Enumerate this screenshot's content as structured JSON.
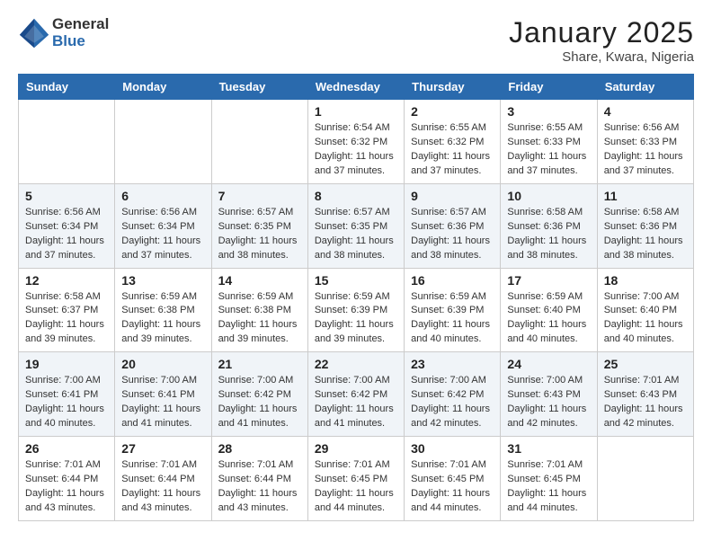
{
  "logo": {
    "general": "General",
    "blue": "Blue"
  },
  "title": "January 2025",
  "location": "Share, Kwara, Nigeria",
  "headers": [
    "Sunday",
    "Monday",
    "Tuesday",
    "Wednesday",
    "Thursday",
    "Friday",
    "Saturday"
  ],
  "weeks": [
    [
      {
        "day": "",
        "info": ""
      },
      {
        "day": "",
        "info": ""
      },
      {
        "day": "",
        "info": ""
      },
      {
        "day": "1",
        "info": "Sunrise: 6:54 AM\nSunset: 6:32 PM\nDaylight: 11 hours and 37 minutes."
      },
      {
        "day": "2",
        "info": "Sunrise: 6:55 AM\nSunset: 6:32 PM\nDaylight: 11 hours and 37 minutes."
      },
      {
        "day": "3",
        "info": "Sunrise: 6:55 AM\nSunset: 6:33 PM\nDaylight: 11 hours and 37 minutes."
      },
      {
        "day": "4",
        "info": "Sunrise: 6:56 AM\nSunset: 6:33 PM\nDaylight: 11 hours and 37 minutes."
      }
    ],
    [
      {
        "day": "5",
        "info": "Sunrise: 6:56 AM\nSunset: 6:34 PM\nDaylight: 11 hours and 37 minutes."
      },
      {
        "day": "6",
        "info": "Sunrise: 6:56 AM\nSunset: 6:34 PM\nDaylight: 11 hours and 37 minutes."
      },
      {
        "day": "7",
        "info": "Sunrise: 6:57 AM\nSunset: 6:35 PM\nDaylight: 11 hours and 38 minutes."
      },
      {
        "day": "8",
        "info": "Sunrise: 6:57 AM\nSunset: 6:35 PM\nDaylight: 11 hours and 38 minutes."
      },
      {
        "day": "9",
        "info": "Sunrise: 6:57 AM\nSunset: 6:36 PM\nDaylight: 11 hours and 38 minutes."
      },
      {
        "day": "10",
        "info": "Sunrise: 6:58 AM\nSunset: 6:36 PM\nDaylight: 11 hours and 38 minutes."
      },
      {
        "day": "11",
        "info": "Sunrise: 6:58 AM\nSunset: 6:36 PM\nDaylight: 11 hours and 38 minutes."
      }
    ],
    [
      {
        "day": "12",
        "info": "Sunrise: 6:58 AM\nSunset: 6:37 PM\nDaylight: 11 hours and 39 minutes."
      },
      {
        "day": "13",
        "info": "Sunrise: 6:59 AM\nSunset: 6:38 PM\nDaylight: 11 hours and 39 minutes."
      },
      {
        "day": "14",
        "info": "Sunrise: 6:59 AM\nSunset: 6:38 PM\nDaylight: 11 hours and 39 minutes."
      },
      {
        "day": "15",
        "info": "Sunrise: 6:59 AM\nSunset: 6:39 PM\nDaylight: 11 hours and 39 minutes."
      },
      {
        "day": "16",
        "info": "Sunrise: 6:59 AM\nSunset: 6:39 PM\nDaylight: 11 hours and 40 minutes."
      },
      {
        "day": "17",
        "info": "Sunrise: 6:59 AM\nSunset: 6:40 PM\nDaylight: 11 hours and 40 minutes."
      },
      {
        "day": "18",
        "info": "Sunrise: 7:00 AM\nSunset: 6:40 PM\nDaylight: 11 hours and 40 minutes."
      }
    ],
    [
      {
        "day": "19",
        "info": "Sunrise: 7:00 AM\nSunset: 6:41 PM\nDaylight: 11 hours and 40 minutes."
      },
      {
        "day": "20",
        "info": "Sunrise: 7:00 AM\nSunset: 6:41 PM\nDaylight: 11 hours and 41 minutes."
      },
      {
        "day": "21",
        "info": "Sunrise: 7:00 AM\nSunset: 6:42 PM\nDaylight: 11 hours and 41 minutes."
      },
      {
        "day": "22",
        "info": "Sunrise: 7:00 AM\nSunset: 6:42 PM\nDaylight: 11 hours and 41 minutes."
      },
      {
        "day": "23",
        "info": "Sunrise: 7:00 AM\nSunset: 6:42 PM\nDaylight: 11 hours and 42 minutes."
      },
      {
        "day": "24",
        "info": "Sunrise: 7:00 AM\nSunset: 6:43 PM\nDaylight: 11 hours and 42 minutes."
      },
      {
        "day": "25",
        "info": "Sunrise: 7:01 AM\nSunset: 6:43 PM\nDaylight: 11 hours and 42 minutes."
      }
    ],
    [
      {
        "day": "26",
        "info": "Sunrise: 7:01 AM\nSunset: 6:44 PM\nDaylight: 11 hours and 43 minutes."
      },
      {
        "day": "27",
        "info": "Sunrise: 7:01 AM\nSunset: 6:44 PM\nDaylight: 11 hours and 43 minutes."
      },
      {
        "day": "28",
        "info": "Sunrise: 7:01 AM\nSunset: 6:44 PM\nDaylight: 11 hours and 43 minutes."
      },
      {
        "day": "29",
        "info": "Sunrise: 7:01 AM\nSunset: 6:45 PM\nDaylight: 11 hours and 44 minutes."
      },
      {
        "day": "30",
        "info": "Sunrise: 7:01 AM\nSunset: 6:45 PM\nDaylight: 11 hours and 44 minutes."
      },
      {
        "day": "31",
        "info": "Sunrise: 7:01 AM\nSunset: 6:45 PM\nDaylight: 11 hours and 44 minutes."
      },
      {
        "day": "",
        "info": ""
      }
    ]
  ]
}
